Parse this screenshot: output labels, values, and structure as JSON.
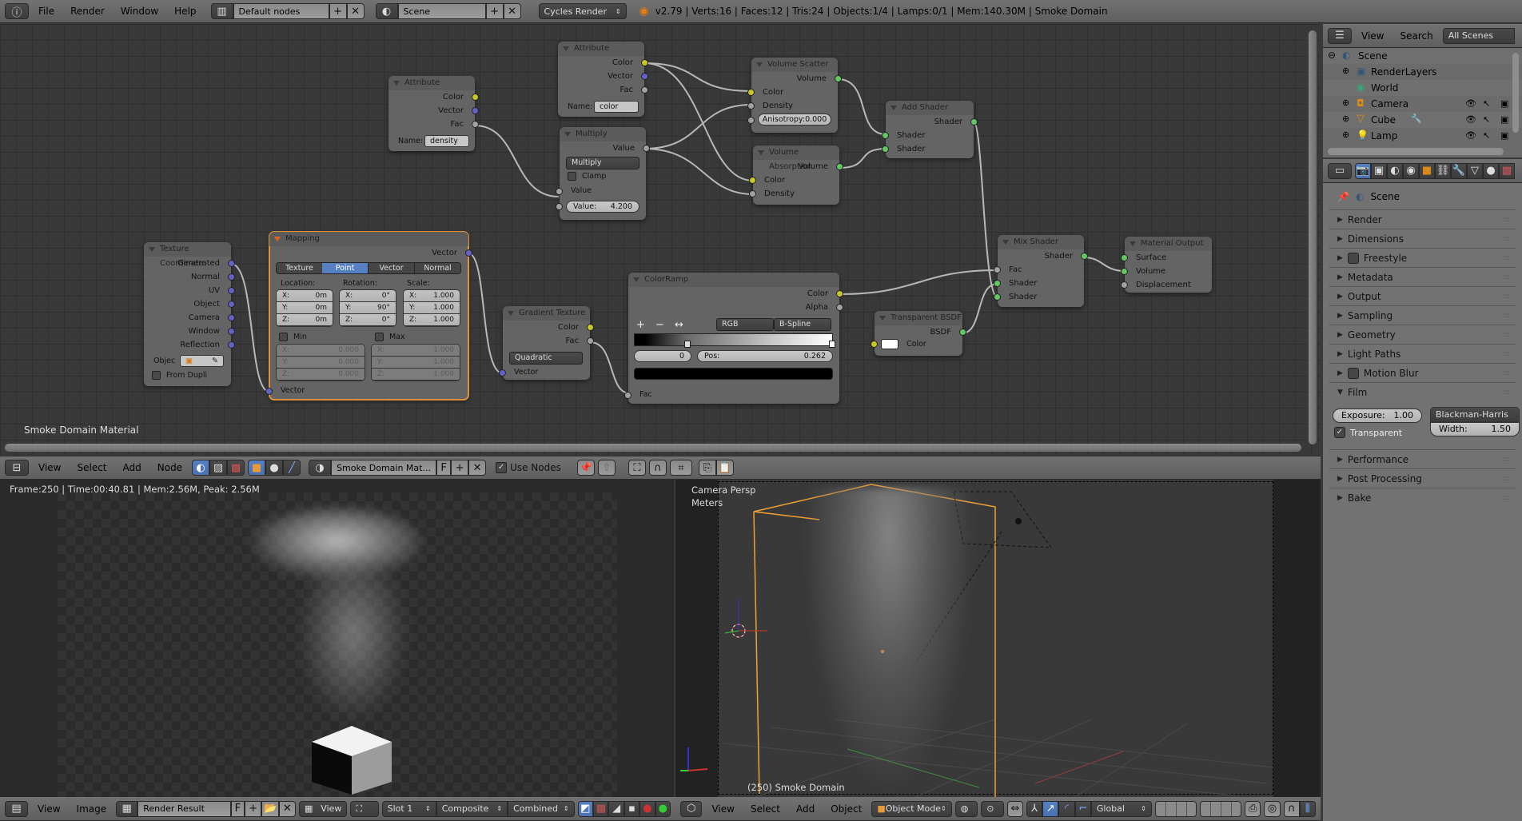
{
  "top_bar": {
    "editor_icon": "info-icon",
    "menus": [
      "File",
      "Render",
      "Window",
      "Help"
    ],
    "screen_layout": "Default nodes",
    "scene": "Scene",
    "render_engine": "Cycles Render",
    "stats": "v2.79 | Verts:16 | Faces:12 | Tris:24 | Objects:1/4 | Lamps:0/1 | Mem:140.30M | Smoke Domain"
  },
  "node_editor": {
    "material_label": "Smoke Domain Material",
    "nodes": {
      "attr_density": {
        "title": "Attribute",
        "outputs": [
          "Color",
          "Vector",
          "Fac"
        ],
        "name_label": "Name:",
        "name_value": "density"
      },
      "attr_color": {
        "title": "Attribute",
        "outputs": [
          "Color",
          "Vector",
          "Fac"
        ],
        "name_label": "Name:",
        "name_value": "color"
      },
      "multiply": {
        "title": "Multiply",
        "output": "Value",
        "operation": "Multiply",
        "clamp_label": "Clamp",
        "input": "Value",
        "value_label": "Value:",
        "value": "4.200"
      },
      "volume_scatter": {
        "title": "Volume Scatter",
        "output": "Volume",
        "inputs": [
          "Color",
          "Density"
        ],
        "anisotropy_label": "Anisotropy:",
        "anisotropy": "0.000"
      },
      "volume_absorption": {
        "title": "Volume Absorption",
        "output": "Volume",
        "inputs": [
          "Color",
          "Density"
        ]
      },
      "add_shader": {
        "title": "Add Shader",
        "output": "Shader",
        "inputs": [
          "Shader",
          "Shader"
        ]
      },
      "texture_coordinate": {
        "title": "Texture Coordinate",
        "outputs": [
          "Generated",
          "Normal",
          "UV",
          "Object",
          "Camera",
          "Window",
          "Reflection"
        ],
        "object_label": "Objec",
        "from_dupli": "From Dupli"
      },
      "mapping": {
        "title": "Mapping",
        "output": "Vector",
        "input": "Vector",
        "tabs": [
          "Texture",
          "Point",
          "Vector",
          "Normal"
        ],
        "active_tab": "Point",
        "location_label": "Location:",
        "rotation_label": "Rotation:",
        "scale_label": "Scale:",
        "location": [
          [
            "X:",
            "0m"
          ],
          [
            "Y:",
            "0m"
          ],
          [
            "Z:",
            "0m"
          ]
        ],
        "rotation": [
          [
            "X:",
            "0°"
          ],
          [
            "Y:",
            "90°"
          ],
          [
            "Z:",
            "0°"
          ]
        ],
        "scale": [
          [
            "X:",
            "1.000"
          ],
          [
            "Y:",
            "1.000"
          ],
          [
            "Z:",
            "1.000"
          ]
        ],
        "min_label": "Min",
        "max_label": "Max",
        "min": [
          [
            "X:",
            "0.000"
          ],
          [
            "Y:",
            "0.000"
          ],
          [
            "Z:",
            "0.000"
          ]
        ],
        "max": [
          [
            "X:",
            "1.000"
          ],
          [
            "Y:",
            "1.000"
          ],
          [
            "Z:",
            "1.000"
          ]
        ]
      },
      "gradient_texture": {
        "title": "Gradient Texture",
        "outputs": [
          "Color",
          "Fac"
        ],
        "type": "Quadratic",
        "input": "Vector"
      },
      "color_ramp": {
        "title": "ColorRamp",
        "outputs": [
          "Color",
          "Alpha"
        ],
        "add": "+",
        "remove": "−",
        "flip": "↔",
        "color_mode": "RGB",
        "interpolation": "B-Spline",
        "active_stop": "0",
        "pos_label": "Pos:",
        "pos": "0.262",
        "stop_color": "#000000",
        "input": "Fac"
      },
      "transparent_bsdf": {
        "title": "Transparent BSDF",
        "output": "BSDF",
        "input": "Color",
        "color": "#ffffff"
      },
      "mix_shader": {
        "title": "Mix Shader",
        "output": "Shader",
        "inputs": [
          "Fac",
          "Shader",
          "Shader"
        ]
      },
      "material_output": {
        "title": "Material Output",
        "inputs": [
          "Surface",
          "Volume",
          "Displacement"
        ]
      }
    }
  },
  "node_header": {
    "menus": [
      "View",
      "Select",
      "Add",
      "Node"
    ],
    "material_name": "Smoke Domain Mat...",
    "fake_user": "F",
    "use_nodes_label": "Use Nodes",
    "use_nodes": true
  },
  "image_editor": {
    "render_info": "Frame:250 | Time:00:40.81 | Mem:2.56M, Peak: 2.56M",
    "menus": [
      "View",
      "Image"
    ],
    "image_name": "Render Result",
    "fake_user": "F",
    "view_label": "View",
    "slot": "Slot 1",
    "composite": "Composite",
    "pass": "Combined"
  },
  "viewport": {
    "view_name": "Camera Persp",
    "units": "Meters",
    "object_info": "(250) Smoke Domain",
    "menus": [
      "View",
      "Select",
      "Add",
      "Object"
    ],
    "mode": "Object Mode",
    "orientation": "Global"
  },
  "outliner": {
    "menus": [
      "View",
      "Search"
    ],
    "display_mode": "All Scenes",
    "items": [
      {
        "label": "Scene",
        "icon": "scene-icon"
      },
      {
        "label": "RenderLayers",
        "icon": "render-layers-icon"
      },
      {
        "label": "World",
        "icon": "world-icon"
      },
      {
        "label": "Camera",
        "icon": "camera-icon"
      },
      {
        "label": "Cube",
        "icon": "mesh-icon"
      },
      {
        "label": "Lamp",
        "icon": "lamp-icon"
      }
    ]
  },
  "properties": {
    "context": "Scene",
    "panels": [
      "Render",
      "Dimensions",
      "Freestyle",
      "Metadata",
      "Output",
      "Sampling",
      "Geometry",
      "Light Paths",
      "Motion Blur",
      "Film"
    ],
    "film": {
      "exposure_label": "Exposure:",
      "exposure": "1.00",
      "filter": "Blackman-Harris",
      "width_label": "Width:",
      "width": "1.50",
      "transparent_label": "Transparent",
      "transparent": true
    },
    "panels_after": [
      "Performance",
      "Post Processing",
      "Bake"
    ]
  }
}
